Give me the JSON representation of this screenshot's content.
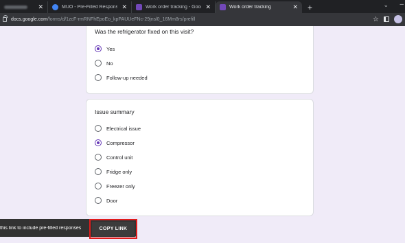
{
  "browser": {
    "tabs": [
      {
        "title": "",
        "favicon_color": "#5f6368",
        "active": false
      },
      {
        "title": "MUO - Pre-Filled Responses Goo",
        "favicon_color": "#4285f4",
        "active": false
      },
      {
        "title": "Work order tracking - Google Fo",
        "favicon_color": "#7248b9",
        "active": false
      },
      {
        "title": "Work order tracking",
        "favicon_color": "#7248b9",
        "active": true
      }
    ],
    "close_glyph": "✕",
    "new_tab_glyph": "+",
    "address": {
      "host": "docs.google.com",
      "path": "/forms/d/1zcF-rmRNFhEpoEo_kpPAUUeFNc-29jnsl0_16Mm8rs/prefill"
    }
  },
  "form": {
    "q1": {
      "title": "Was the refrigerator fixed on this visit?",
      "options": [
        {
          "label": "Yes",
          "checked": true
        },
        {
          "label": "No",
          "checked": false
        },
        {
          "label": "Follow-up needed",
          "checked": false
        }
      ]
    },
    "q2": {
      "title": "Issue summary",
      "options": [
        {
          "label": "Electrical issue",
          "checked": false
        },
        {
          "label": "Compressor",
          "checked": true
        },
        {
          "label": "Control unit",
          "checked": false
        },
        {
          "label": "Fridge only",
          "checked": false
        },
        {
          "label": "Freezer only",
          "checked": false
        },
        {
          "label": "Door",
          "checked": false
        }
      ]
    }
  },
  "snackbar": {
    "message": "this link to include pre-filled responses",
    "action": "COPY LINK"
  },
  "colors": {
    "accent": "#673ab7",
    "background": "#f0ebf8",
    "highlight": "#e01b1b"
  }
}
